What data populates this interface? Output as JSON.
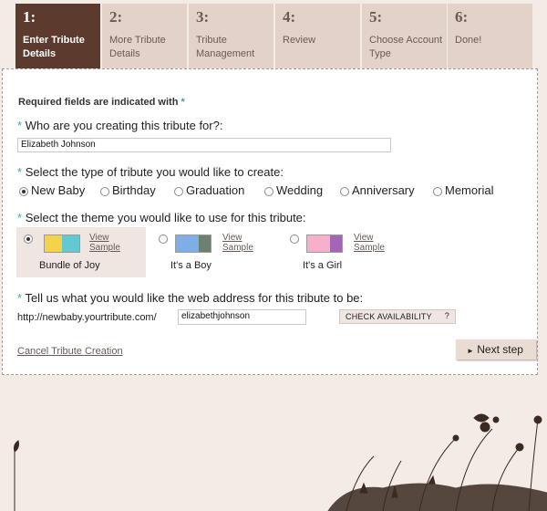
{
  "steps": [
    {
      "num": "1:",
      "label": "Enter Tribute Details"
    },
    {
      "num": "2:",
      "label": "More Tribute Details"
    },
    {
      "num": "3:",
      "label": "Tribute Management"
    },
    {
      "num": "4:",
      "label": "Review"
    },
    {
      "num": "5:",
      "label": "Choose Account Type"
    },
    {
      "num": "6:",
      "label": "Done!"
    }
  ],
  "form": {
    "required_note": "Required fields are indicated with",
    "required_star": "*",
    "who_question": "Who are you creating this tribute for?:",
    "who_value": "Elizabeth Johnson",
    "type_question": "Select the type of tribute you would like to create:",
    "types": [
      "New Baby",
      "Birthday",
      "Graduation",
      "Wedding",
      "Anniversary",
      "Memorial"
    ],
    "selected_type": "New Baby",
    "theme_question": "Select the theme you would like to use for this tribute:",
    "themes": [
      {
        "name": "Bundle of Joy",
        "view_label": "View Sample",
        "colors": [
          "#f4d24a",
          "#63c9d0"
        ]
      },
      {
        "name": "It's a Boy",
        "view_label": "View Sample",
        "colors": [
          "#7eaee4",
          "#6c8170"
        ]
      },
      {
        "name": "It's a Girl",
        "view_label": "View Sample",
        "colors": [
          "#f7b0cc",
          "#a366b5"
        ]
      }
    ],
    "selected_theme": "Bundle of Joy",
    "web_question": "Tell us what you would like the web address for this tribute to be:",
    "url_prefix": "http://newbaby.yourtribute.com/",
    "url_value": "elizabethjohnson",
    "check_label": "CHECK AVAILABILITY",
    "check_help": "?",
    "cancel_label": "Cancel Tribute Creation",
    "next_label": "Next step",
    "next_arrow": "►"
  },
  "colors": {
    "active_step": "#5c3a2e",
    "inactive_step": "#e2d2c9",
    "accent_star": "#3ba6b6",
    "page_bg": "#f3ebe5"
  }
}
